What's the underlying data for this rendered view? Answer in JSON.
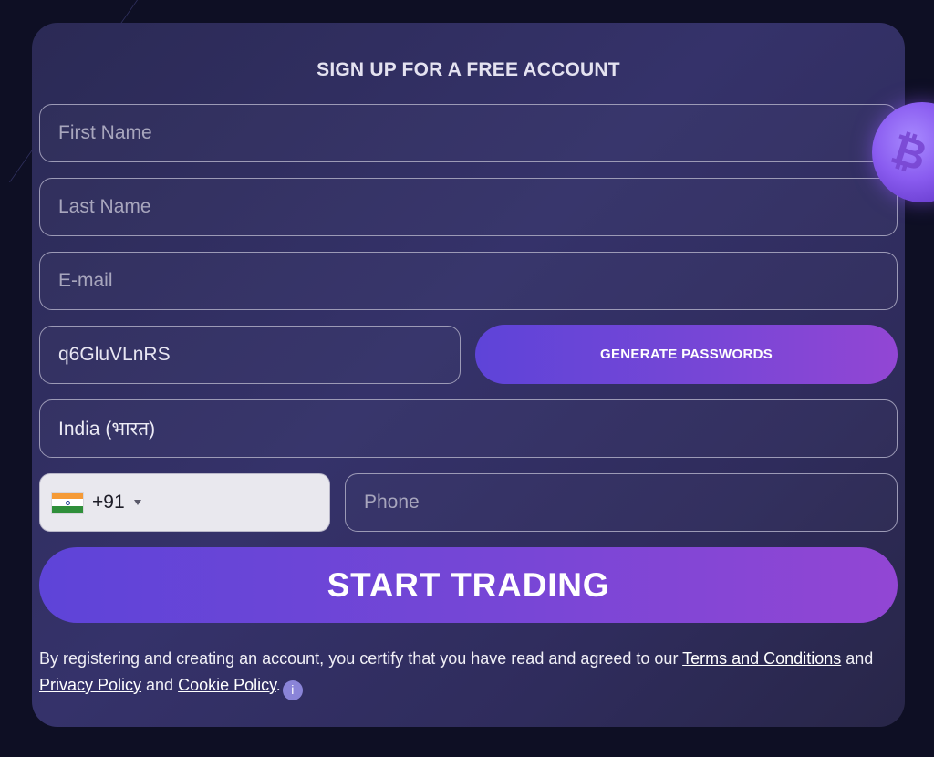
{
  "form": {
    "title": "SIGN UP FOR A FREE ACCOUNT",
    "first_name_placeholder": "First Name",
    "last_name_placeholder": "Last Name",
    "email_placeholder": "E-mail",
    "password_value": "q6GluVLnRS",
    "generate_label": "GENERATE PASSWORDS",
    "country_value": "India (भारत)",
    "dial_code": "+91",
    "phone_placeholder": "Phone",
    "submit_label": "START TRADING"
  },
  "legal": {
    "text_before": "By registering and creating an account, you certify that you have read and agreed to our ",
    "terms_link": "Terms and Conditions",
    "and_1": " and ",
    "privacy_link": "Privacy Policy",
    "and_2": " and ",
    "cookie_link": "Cookie Policy",
    "end": ".",
    "info_glyph": "i"
  },
  "decor": {
    "coin_symbol": "₿",
    "coin_icon": "bitcoin-coin-icon",
    "flag_icon": "india-flag-icon"
  },
  "colors": {
    "background": "#0e0f24",
    "card": "#2f2c5c",
    "button_gradient_start": "#5e44d8",
    "button_gradient_end": "#9246d4"
  }
}
